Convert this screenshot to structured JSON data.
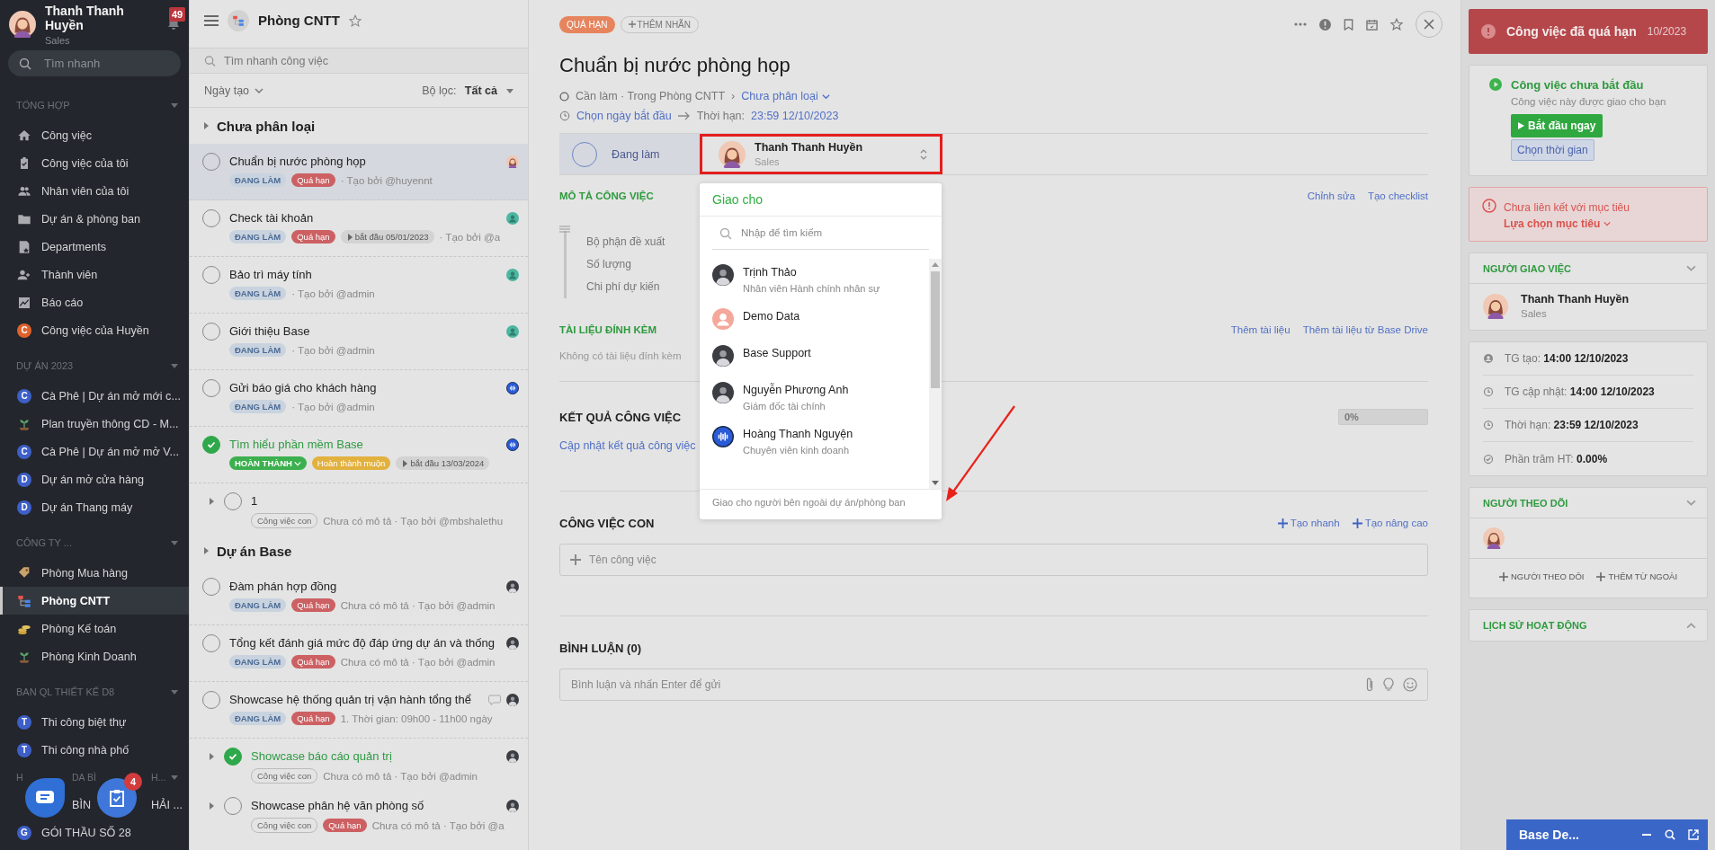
{
  "sidebar": {
    "user": {
      "name": "Thanh Thanh Huyền",
      "role": "Sales",
      "avatar": {
        "kind": "woman"
      }
    },
    "notification_count": "49",
    "search": {
      "placeholder": "Tìm nhanh"
    },
    "sections": [
      {
        "title": "TỔNG HỢP",
        "expanded": true,
        "items": [
          {
            "label": "Công việc",
            "kind": "home",
            "selected": false
          },
          {
            "label": "Công việc của tôi",
            "kind": "clipboard",
            "selected": false
          },
          {
            "label": "Nhân viên của tôi",
            "kind": "people",
            "selected": false
          },
          {
            "label": "Dự án & phòng ban",
            "kind": "folder",
            "selected": false
          },
          {
            "label": "Departments",
            "kind": "departments",
            "selected": false
          },
          {
            "label": "Thành viên",
            "kind": "member",
            "selected": false
          },
          {
            "label": "Báo cáo",
            "kind": "chart",
            "selected": false
          },
          {
            "label": "Công việc của Huyền",
            "kind": "letter",
            "letter": "C",
            "color": "#e0622a",
            "selected": false
          }
        ]
      },
      {
        "title": "DỰ ÁN 2023",
        "expanded": true,
        "items": [
          {
            "label": "Cà Phê | Dự án mở mới c...",
            "kind": "letter",
            "letter": "C",
            "color": "#3d5fc7",
            "selected": false
          },
          {
            "label": "Plan truyền thông CD - M...",
            "kind": "plant",
            "selected": false
          },
          {
            "label": "Cà Phê | Dự án mở mở V...",
            "kind": "letter",
            "letter": "C",
            "color": "#3d5fc7",
            "selected": false
          },
          {
            "label": "Dự án mở cửa hàng",
            "kind": "letter",
            "letter": "D",
            "color": "#3d5fc7",
            "selected": false
          },
          {
            "label": "Dự án Thang máy",
            "kind": "letter",
            "letter": "D",
            "color": "#3d5fc7",
            "selected": false
          }
        ]
      },
      {
        "title": "CÔNG TY ...",
        "expanded": true,
        "items": [
          {
            "label": "Phòng Mua hàng",
            "kind": "tag",
            "selected": false
          },
          {
            "label": "Phòng CNTT",
            "kind": "dept",
            "selected": true
          },
          {
            "label": "Phòng Kế toán",
            "kind": "coins",
            "selected": false
          },
          {
            "label": "Phòng Kinh Doanh",
            "kind": "plant",
            "selected": false
          }
        ]
      },
      {
        "title": "BAN QL THIẾT KẾ D8",
        "expanded": true,
        "items": [
          {
            "label": "Thi công biệt thự",
            "kind": "letter",
            "letter": "T",
            "color": "#3d5fc7",
            "selected": false
          },
          {
            "label": "Thi công nhà phố",
            "kind": "letter",
            "letter": "T",
            "color": "#3d5fc7",
            "selected": false
          }
        ]
      },
      {
        "title_fragments": [
          "H",
          "DA BÌ",
          "H..."
        ],
        "expanded": true,
        "items": [
          {
            "fragments": [
              "BÌN",
              "HẢI ..."
            ],
            "selected": false
          },
          {
            "label": "GÓI THẦU SỐ 28",
            "kind": "letter",
            "letter": "G",
            "color": "#3d5fc7",
            "selected": false
          }
        ]
      }
    ]
  },
  "floating_buttons": {
    "task_badge": "4"
  },
  "task_list": {
    "title": "Phòng CNTT",
    "search": {
      "placeholder": "Tìm nhanh công việc"
    },
    "sort": "Ngày tạo",
    "filter_label": "Bộ lọc:",
    "filter_value": "Tất cả",
    "groups": [
      {
        "title": "Chưa phân loại",
        "tasks": [
          {
            "title": "Chuẩn bị nước phòng họp",
            "done": false,
            "selected": true,
            "status": {
              "kind": "doing",
              "text": "ĐANG LÀM"
            },
            "tags": [
              {
                "kind": "overdue",
                "text": "Quá hạn"
              }
            ],
            "meta": "· Tạo bởi @huyennt",
            "avatar": {
              "kind": "woman"
            },
            "sub": false
          },
          {
            "title": "Check tài khoản",
            "done": false,
            "selected": false,
            "status": {
              "kind": "doing",
              "text": "ĐANG LÀM"
            },
            "tags": [
              {
                "kind": "overdue",
                "text": "Quá hạn"
              },
              {
                "kind": "start",
                "text": "bắt đầu 05/01/2023"
              }
            ],
            "meta": "· Tạo bởi @a",
            "avatar": {
              "kind": "person"
            },
            "sub": false
          },
          {
            "title": "Bảo trì máy tính",
            "done": false,
            "selected": false,
            "status": {
              "kind": "doing",
              "text": "ĐANG LÀM"
            },
            "meta": "· Tạo bởi @admin",
            "avatar": {
              "kind": "person"
            },
            "sub": false
          },
          {
            "title": "Giới thiệu Base",
            "done": false,
            "selected": false,
            "status": {
              "kind": "doing",
              "text": "ĐANG LÀM"
            },
            "meta": "· Tạo bởi @admin",
            "avatar": {
              "kind": "person"
            },
            "sub": false
          },
          {
            "title": "Gửi báo giá cho khách hàng",
            "done": false,
            "selected": false,
            "status": {
              "kind": "doing",
              "text": "ĐANG LÀM"
            },
            "meta": "· Tạo bởi @admin",
            "avatar": {
              "kind": "wave"
            },
            "sub": false
          },
          {
            "title": "Tìm hiểu phần mềm Base",
            "done": true,
            "selected": false,
            "status": {
              "kind": "done",
              "text": "HOÀN THÀNH"
            },
            "tags": [
              {
                "kind": "late",
                "text": "Hoàn thành muộn"
              },
              {
                "kind": "start",
                "text": "bắt đầu 13/03/2024"
              }
            ],
            "avatar": {
              "kind": "wave"
            },
            "sub": false
          },
          {
            "title": "1",
            "done": false,
            "selected": false,
            "tags": [
              {
                "kind": "sub",
                "text": "Công việc con"
              }
            ],
            "meta": "Chưa có mô tả · Tạo bởi @mbshalethu",
            "sub": true
          }
        ]
      },
      {
        "title": "Dự án Base",
        "tasks": [
          {
            "title": "Đàm phán hợp đồng",
            "done": false,
            "selected": false,
            "status": {
              "kind": "doing",
              "text": "ĐANG LÀM"
            },
            "tags": [
              {
                "kind": "overdue",
                "text": "Quá hạn"
              }
            ],
            "meta": "Chưa có mô tả · Tạo bởi @admin",
            "avatar": {
              "kind": "photo"
            },
            "sub": false
          },
          {
            "title": "Tổng kết đánh giá mức độ đáp ứng dự án và thống",
            "done": false,
            "selected": false,
            "status": {
              "kind": "doing",
              "text": "ĐANG LÀM"
            },
            "tags": [
              {
                "kind": "overdue",
                "text": "Quá hạn"
              }
            ],
            "meta": "Chưa có mô tả · Tạo bởi @admin",
            "avatar": {
              "kind": "photo"
            },
            "sub": false
          },
          {
            "title": "Showcase hệ thống quản trị vận hành tổng thể",
            "done": false,
            "selected": false,
            "comment": true,
            "status": {
              "kind": "doing",
              "text": "ĐANG LÀM"
            },
            "tags": [
              {
                "kind": "overdue",
                "text": "Quá hạn"
              }
            ],
            "meta": "1. Thời gian: 09h00 - 11h00 ngày",
            "avatar": {
              "kind": "photo"
            },
            "sub": false
          },
          {
            "title": "Showcase báo cáo quản trị",
            "done": true,
            "selected": false,
            "tags": [
              {
                "kind": "sub",
                "text": "Công việc con"
              }
            ],
            "meta": "Chưa có mô tả · Tạo bởi @admin",
            "avatar": {
              "kind": "photo"
            },
            "sub": true
          },
          {
            "title": "Showcase phân hệ văn phòng số",
            "done": false,
            "selected": false,
            "tags": [
              {
                "kind": "sub",
                "text": "Công việc con"
              },
              {
                "kind": "overdue",
                "text": "Quá hạn"
              }
            ],
            "meta": "Chưa có mô tả · Tạo bởi @a",
            "avatar": {
              "kind": "photo"
            },
            "sub": true
          }
        ]
      }
    ]
  },
  "detail": {
    "labels": [
      {
        "kind": "overdue",
        "text": "QUÁ HẠN"
      }
    ],
    "add_label": "THÊM NHÃN",
    "title": "Chuẩn bị nước phòng họp",
    "location": "Cần làm · Trong Phòng CNTT",
    "separator": "›",
    "category": "Chưa phân loại",
    "start_link": "Chọn ngày bắt đầu",
    "deadline_label": "Thời hạn:",
    "deadline": "23:59 12/10/2023",
    "status": "Đang làm",
    "assignee": {
      "name": "Thanh Thanh Huyền",
      "role": "Sales",
      "avatar": {
        "kind": "woman"
      }
    },
    "assign_dropdown": {
      "title": "Giao cho",
      "search": {
        "placeholder": "Nhập để tìm kiếm"
      },
      "people": [
        {
          "name": "Trịnh Thảo",
          "role": "Nhân viên Hành chính nhân sự",
          "avatar": {
            "kind": "photo"
          }
        },
        {
          "name": "Demo Data",
          "avatar": {
            "kind": "pink"
          }
        },
        {
          "name": "Base Support",
          "avatar": {
            "kind": "photo"
          }
        },
        {
          "name": "Nguyễn Phương Anh",
          "role": "Giám đốc tài chính",
          "avatar": {
            "kind": "photo"
          }
        },
        {
          "name": "Hoàng Thanh Nguyện",
          "role": "Chuyên viên kinh doanh",
          "avatar": {
            "kind": "wave"
          }
        }
      ],
      "footer": "Giao cho người bên ngoài dự án/phòng ban"
    },
    "description": {
      "title": "MÔ TẢ CÔNG VIỆC",
      "actions": [
        "Chỉnh sửa",
        "Tạo checklist"
      ],
      "lines": [
        "Bộ phận đề xuất",
        "Số lượng",
        "Chi phí dự kiến"
      ]
    },
    "attachments": {
      "title": "TÀI LIỆU ĐÍNH KÈM",
      "actions": [
        "Thêm tài liệu",
        "Thêm tài liệu từ Base Drive"
      ],
      "empty": "Không có tài liệu đính kèm"
    },
    "result": {
      "title": "KẾT QUẢ CÔNG VIỆC",
      "link": "Cập nhật kết quả công việc",
      "progress": {
        "level": 0,
        "reading": "0%"
      }
    },
    "subtasks": {
      "title": "CÔNG VIỆC CON",
      "actions": [
        "Tạo nhanh",
        "Tạo nâng cao"
      ],
      "placeholder": "Tên công việc"
    },
    "comments": {
      "title": "BÌNH LUẬN (0)",
      "placeholder": "Bình luận và nhấn Enter để gửi"
    }
  },
  "right_panel": {
    "overdue_banner": {
      "text": "Công việc đã quá hạn",
      "date": "10/2023"
    },
    "start_card": {
      "title": "Công việc chưa bắt đầu",
      "subtitle": "Công việc này được giao cho bạn",
      "start_button": "Bắt đầu ngay",
      "time_button": "Chọn thời gian"
    },
    "goal_warning": {
      "text": "Chưa liên kết với mục tiêu",
      "link": "Lựa chọn mục tiêu"
    },
    "assigner": {
      "title": "NGƯỜI GIAO VIỆC",
      "expanded": true,
      "name": "Thanh Thanh Huyền",
      "role": "Sales",
      "avatar": {
        "kind": "woman"
      }
    },
    "info": [
      {
        "kind": "user",
        "label": "TG tạo:",
        "value": "14:00 12/10/2023"
      },
      {
        "kind": "clock",
        "label": "TG cập nhật:",
        "value": "14:00 12/10/2023"
      },
      {
        "kind": "clock",
        "label": "Thời hạn:",
        "value": "23:59 12/10/2023"
      },
      {
        "kind": "check",
        "label": "Phần trăm HT:",
        "value": "**0.00**%"
      }
    ],
    "followers": {
      "title": "NGƯỜI THEO DÕI",
      "expanded": true,
      "avatars": [
        {
          "kind": "woman"
        }
      ],
      "actions": [
        "NGƯỜI THEO DÕI",
        "THÊM TỪ NGOÀI"
      ]
    },
    "history": {
      "title": "LỊCH SỬ HOẠT ĐỘNG",
      "expanded": false
    },
    "chat_bar": {
      "title": "Base De..."
    }
  }
}
